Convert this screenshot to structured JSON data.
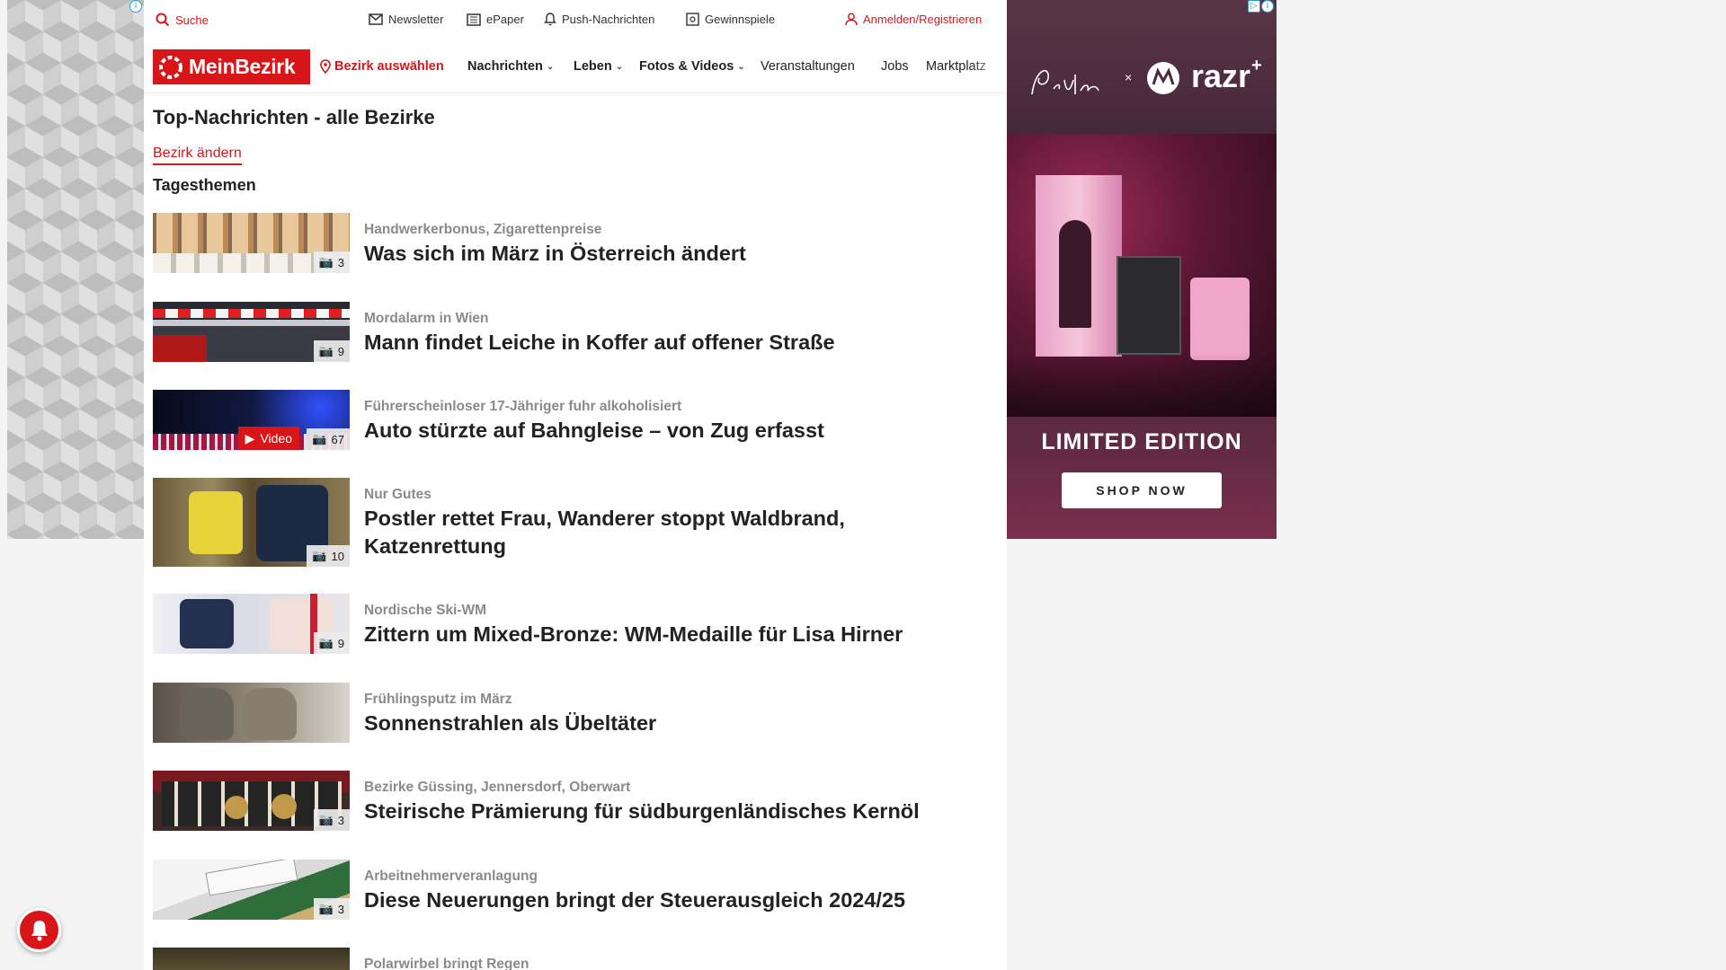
{
  "topbar": {
    "search": "Suche",
    "newsletter": "Newsletter",
    "epaper": "ePaper",
    "push": "Push-Nachrichten",
    "games": "Gewinnspiele",
    "login": "Anmelden/Registrieren"
  },
  "nav": {
    "logo": "MeinBezirk",
    "district_select": "Bezirk auswählen",
    "items": [
      "Nachrichten",
      "Leben",
      "Fotos & Videos",
      "Veranstaltungen",
      "Jobs",
      "Marktplatz"
    ]
  },
  "page": {
    "title": "Top-Nachrichten - alle Bezirke",
    "change_district": "Bezirk ändern",
    "section": "Tagesthemen"
  },
  "articles": [
    {
      "kicker": "Handwerkerbonus, Zigarettenpreise",
      "title": "Was sich im März in Österreich ändert",
      "photos": "3",
      "video": ""
    },
    {
      "kicker": "Mordalarm in Wien",
      "title": "Mann findet Leiche in Koffer auf offener Straße",
      "photos": "9",
      "video": ""
    },
    {
      "kicker": "Führerscheinloser 17-Jähriger fuhr alkoholisiert",
      "title": "Auto stürzte auf Bahngleise – von Zug erfasst",
      "photos": "67",
      "video": "Video"
    },
    {
      "kicker": "Nur Gutes",
      "title": "Postler rettet Frau, Wanderer stoppt Waldbrand, Katzenrettung",
      "photos": "10",
      "video": ""
    },
    {
      "kicker": "Nordische Ski-WM",
      "title": "Zittern um Mixed-Bronze: WM-Medaille für Lisa Hirner",
      "photos": "9",
      "video": ""
    },
    {
      "kicker": "Frühlingsputz im März",
      "title": "Sonnenstrahlen als Übeltäter",
      "photos": "",
      "video": ""
    },
    {
      "kicker": "Bezirke Güssing, Jennersdorf, Oberwart",
      "title": "Steirische Prämierung für südburgenländisches Kernöl",
      "photos": "3",
      "video": ""
    },
    {
      "kicker": "Arbeitnehmerveranlagung",
      "title": "Diese Neuerungen bringt der Steuerausgleich 2024/25",
      "photos": "3",
      "video": ""
    },
    {
      "kicker": "Polarwirbel bringt Regen",
      "title": "",
      "photos": "",
      "video": ""
    }
  ],
  "ad_right": {
    "brand": "razr",
    "brand_sup": "+",
    "x": "×",
    "tagline": "LIMITED EDITION",
    "cta": "SHOP NOW"
  },
  "colors": {
    "accent": "#d8161a",
    "kicker": "#8a8a8a"
  }
}
